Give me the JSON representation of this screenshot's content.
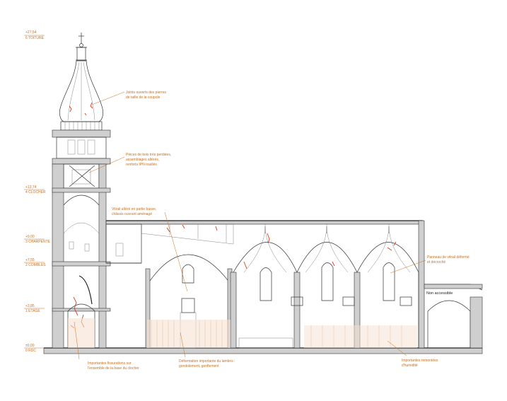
{
  "levels": [
    {
      "value": "+27,54",
      "name": "6 TOITURE"
    },
    {
      "value": "+13,74",
      "name": "4 CLOCHER"
    },
    {
      "value": "+9,00",
      "name": "3 CHARPENTE"
    },
    {
      "value": "+7,55",
      "name": "2 COMBLES"
    },
    {
      "value": "+3,85",
      "name": "1 ETAGE"
    },
    {
      "value": "±0,00",
      "name": "0 RDC"
    }
  ],
  "annotations": {
    "dome": [
      "Joints ouverts des pierres",
      "de taille de la coupole"
    ],
    "beams": [
      "Pièces de bois très perdiées,",
      "assemblages altérés,",
      "renforts IPN rouillés"
    ],
    "window": [
      "Vitrail altéré en partie basse,",
      "châssis ouvrant aménagé"
    ],
    "stained": [
      "Panneau de vitrail déformé",
      "et décroché"
    ],
    "cracks": [
      "Importantes fissurations sur",
      "l'ensemble de la base du clocher"
    ],
    "panelling": [
      "Déformation importante du lambris :",
      "gondolement, gonflement"
    ],
    "humidity": [
      "Importantes remontées",
      "d'humidité"
    ],
    "access": "Non accessible"
  },
  "colors": {
    "annotation": "#c8701e",
    "crack": "#d23b1e",
    "line": "#333333"
  }
}
